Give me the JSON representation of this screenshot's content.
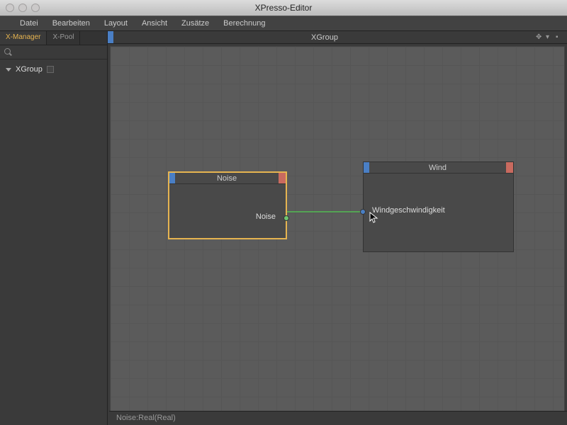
{
  "window": {
    "title": "XPresso-Editor"
  },
  "menu": {
    "file": "Datei",
    "edit": "Bearbeiten",
    "layout": "Layout",
    "view": "Ansicht",
    "extras": "Zusätze",
    "calc": "Berechnung"
  },
  "sidebar": {
    "tabs": {
      "manager": "X-Manager",
      "pool": "X-Pool"
    },
    "tree": {
      "root": "XGroup"
    }
  },
  "canvas": {
    "header_title": "XGroup",
    "nodes": {
      "noise": {
        "title": "Noise",
        "output_label": "Noise"
      },
      "wind": {
        "title": "Wind",
        "input_label": "Windgeschwindigkeit"
      }
    }
  },
  "status": {
    "text": "Noise:Real(Real)"
  }
}
